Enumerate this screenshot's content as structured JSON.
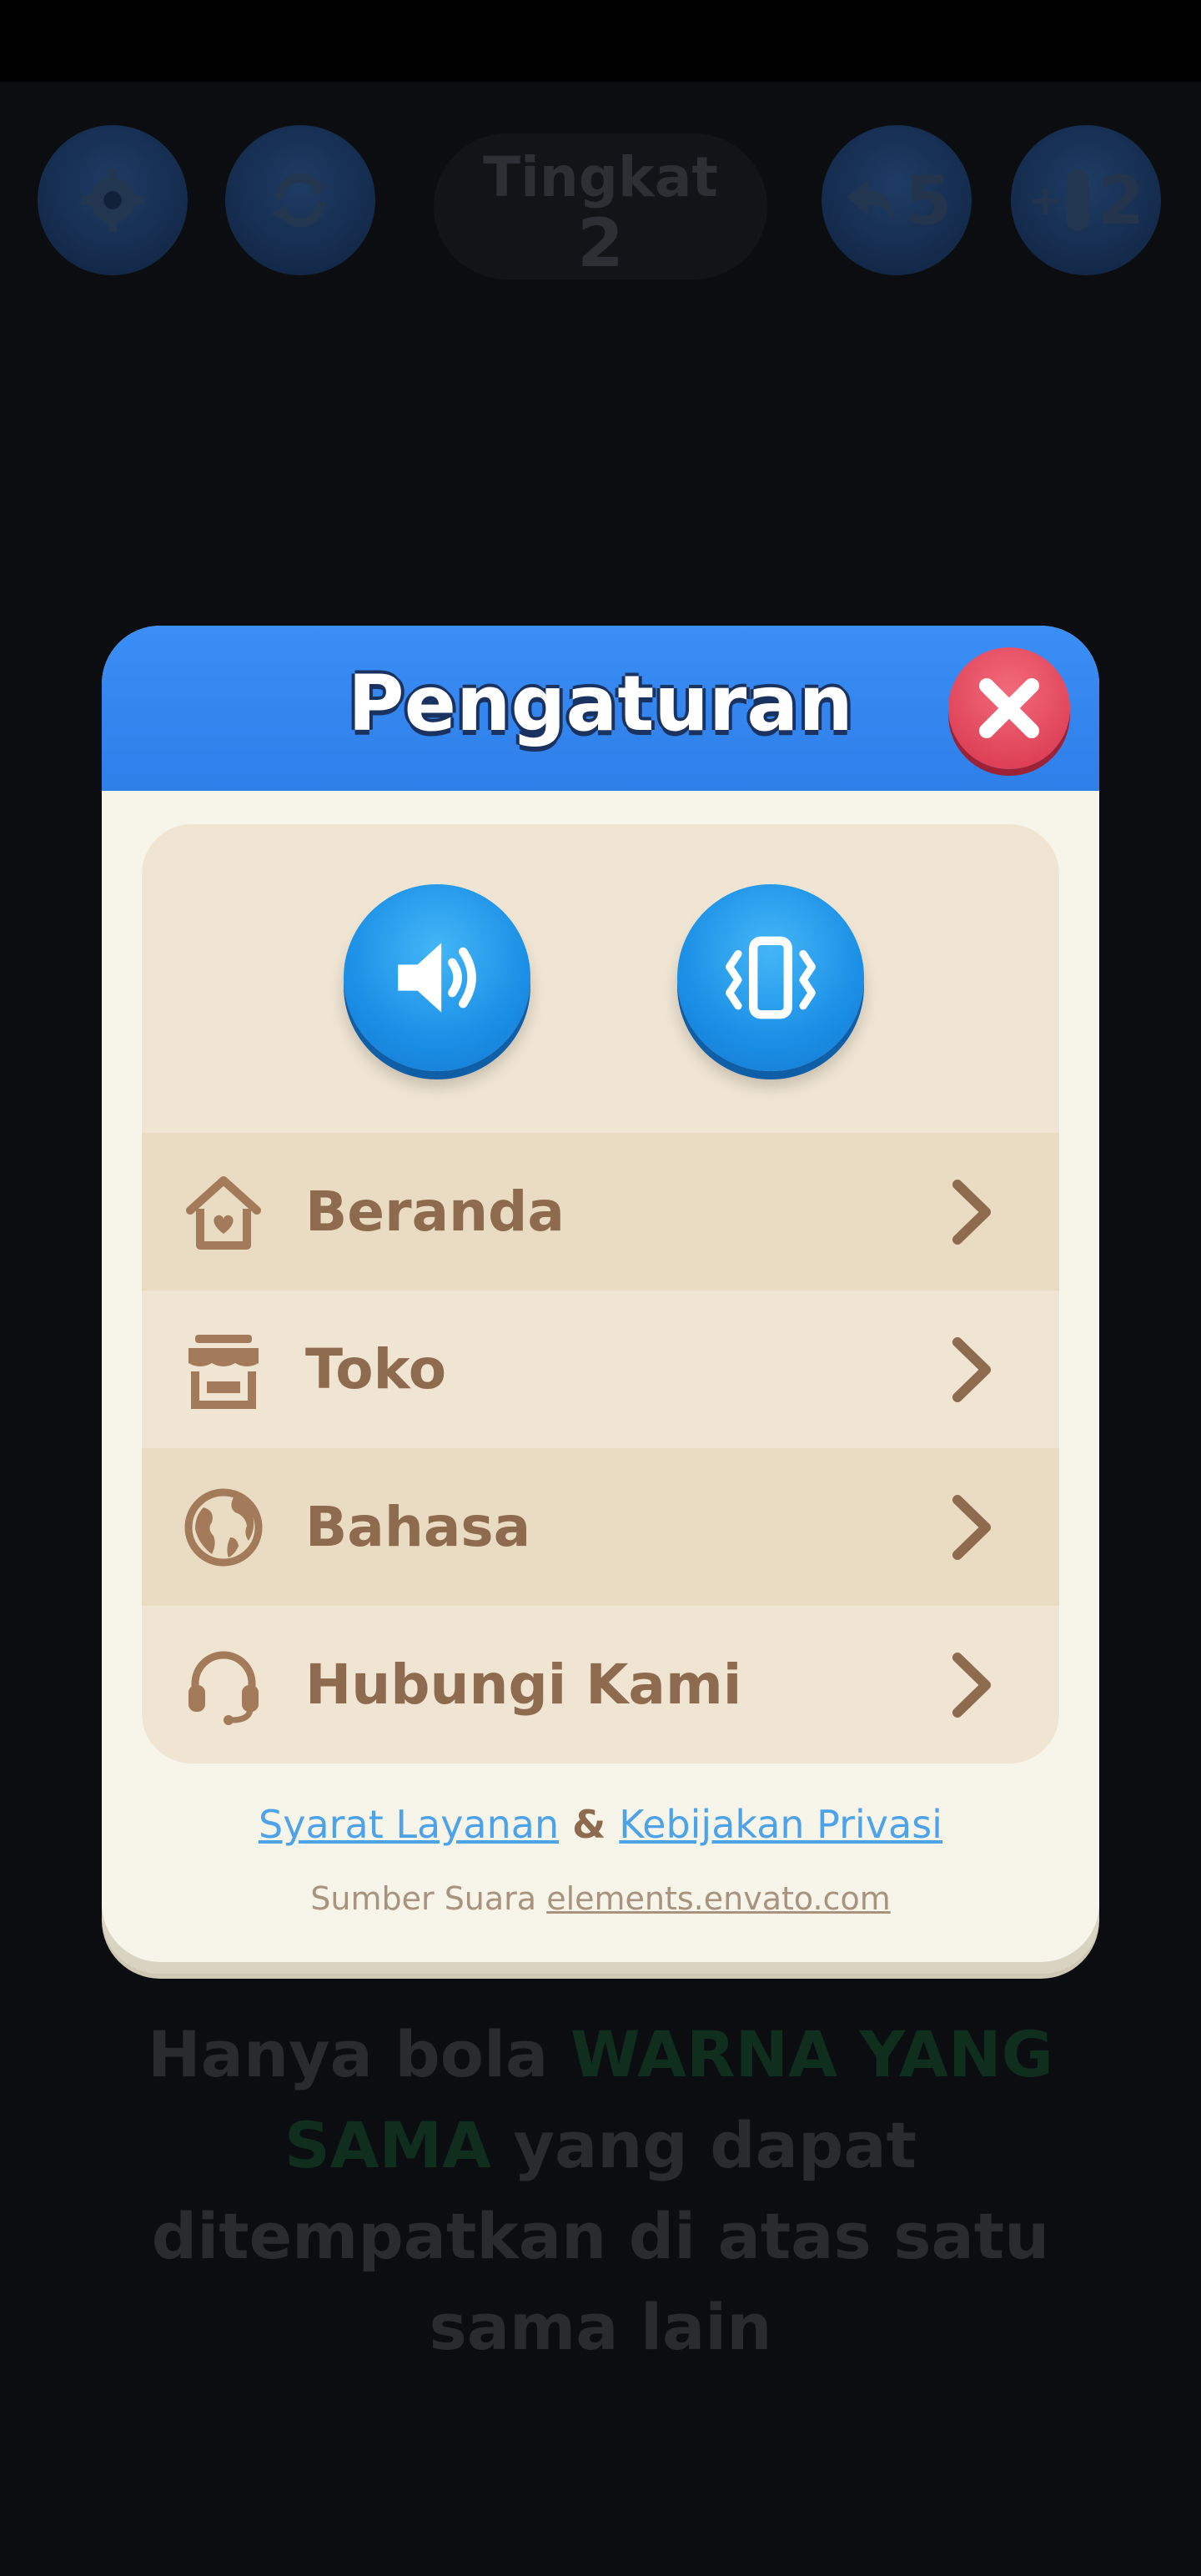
{
  "topbar": {
    "level_label": "Tingkat",
    "level_value": "2",
    "undo_count": "5",
    "add_tube_count": "2"
  },
  "hint": {
    "part1": "Hanya bola ",
    "highlight": "WARNA YANG SAMA",
    "part2": " yang dapat ditempatkan di atas satu sama lain"
  },
  "dialog": {
    "title": "Pengaturan",
    "menu": [
      {
        "label": "Beranda",
        "icon": "home-icon"
      },
      {
        "label": "Toko",
        "icon": "shop-icon"
      },
      {
        "label": "Bahasa",
        "icon": "globe-icon"
      },
      {
        "label": "Hubungi Kami",
        "icon": "headset-icon"
      }
    ],
    "terms_label": "Syarat Layanan",
    "and_label": "&",
    "privacy_label": "Kebijakan Privasi",
    "source_prefix": "Sumber Suara",
    "source_link": "elements.envato.com"
  },
  "colors": {
    "header_blue": "#3a8ef5",
    "close_red": "#e04a5e",
    "menu_text": "#8e6a4e",
    "link_blue": "#4ca3ea"
  }
}
